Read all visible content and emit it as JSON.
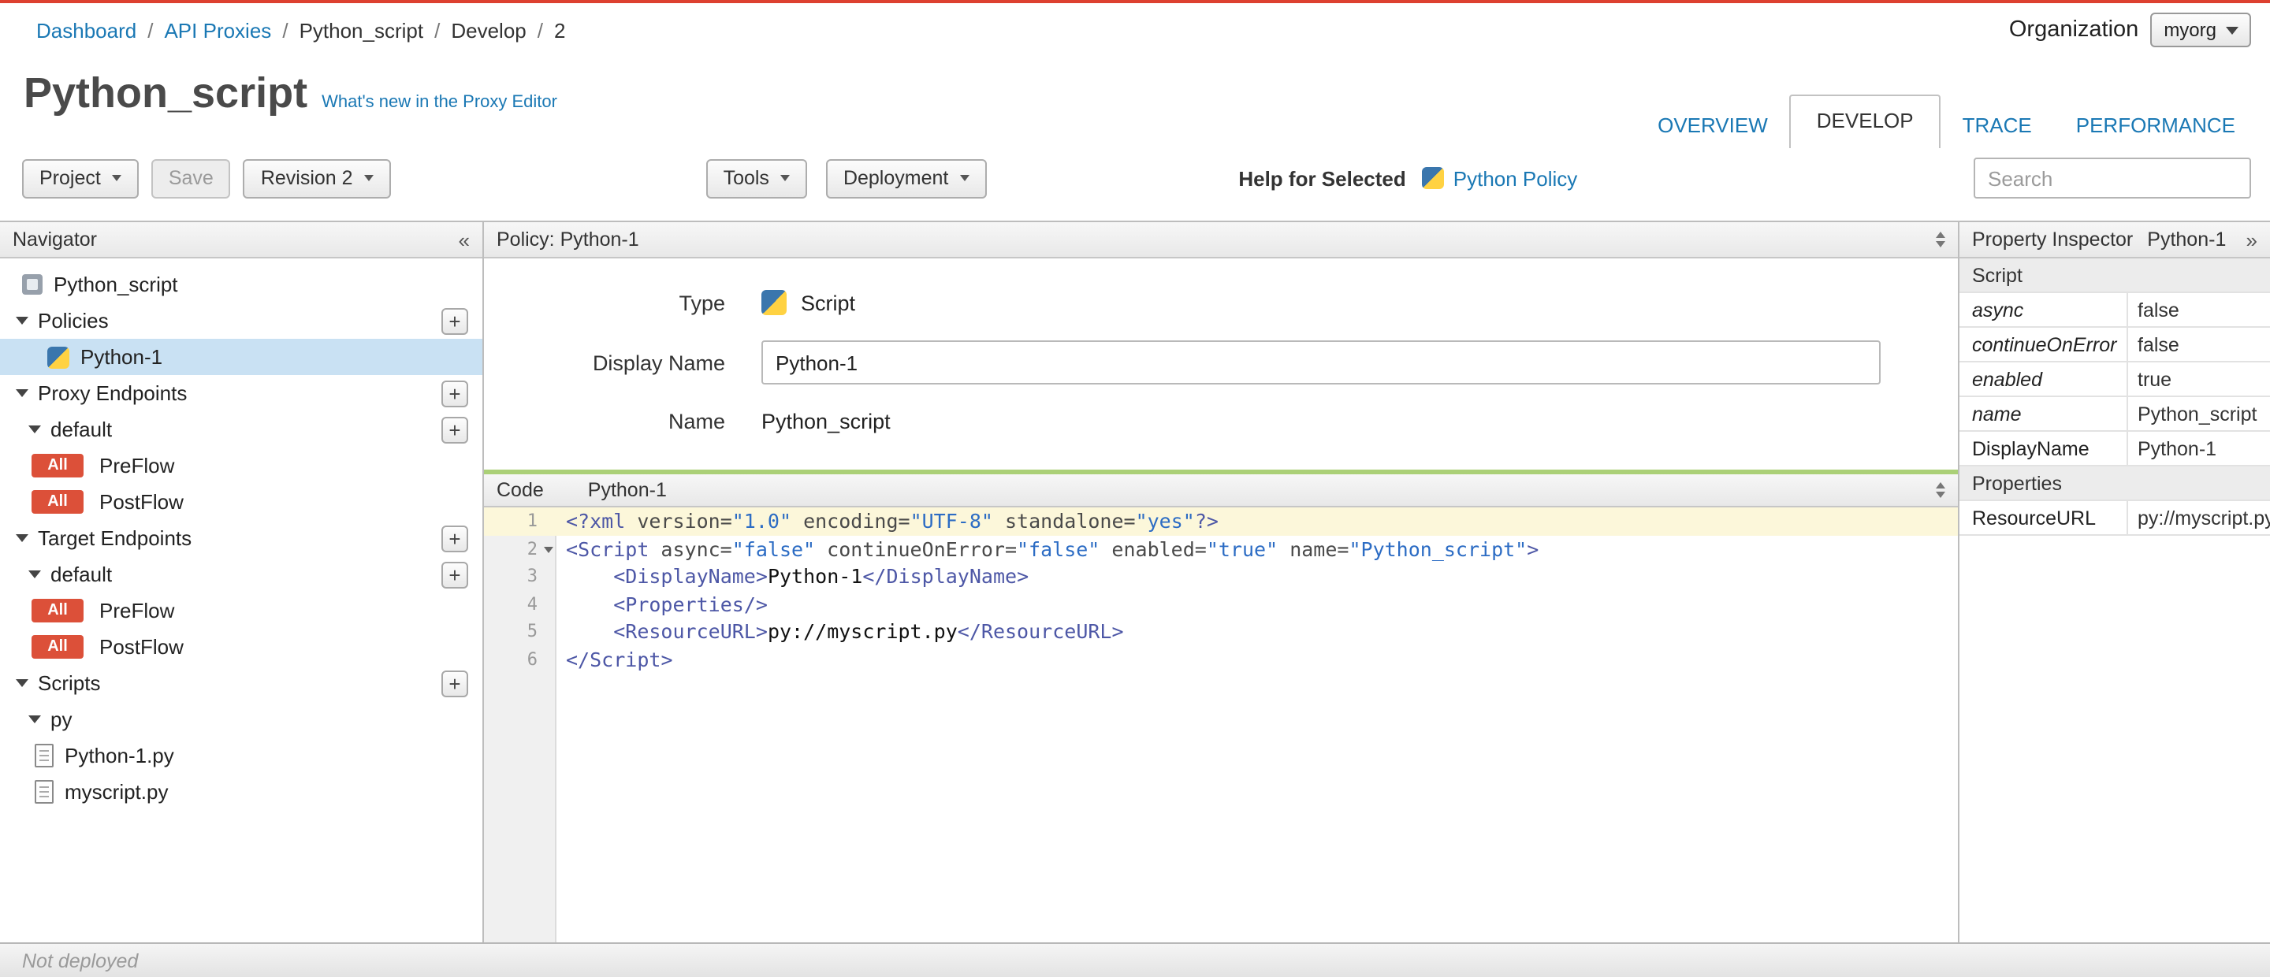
{
  "breadcrumb": {
    "separator": "/",
    "items": [
      {
        "label": "Dashboard",
        "link": true
      },
      {
        "label": "API Proxies",
        "link": true
      },
      {
        "label": "Python_script",
        "link": false
      },
      {
        "label": "Develop",
        "link": false
      },
      {
        "label": "2",
        "link": false
      }
    ]
  },
  "org": {
    "label": "Organization",
    "value": "myorg"
  },
  "header": {
    "title": "Python_script",
    "whats_new": "What's new in the Proxy Editor"
  },
  "tabs": [
    {
      "label": "OVERVIEW",
      "active": false
    },
    {
      "label": "DEVELOP",
      "active": true
    },
    {
      "label": "TRACE",
      "active": false
    },
    {
      "label": "PERFORMANCE",
      "active": false
    }
  ],
  "toolbar": {
    "project": "Project",
    "save": "Save",
    "revision": "Revision 2",
    "tools": "Tools",
    "deployment": "Deployment",
    "help_for_selected": "Help for Selected",
    "policy_link": "Python Policy",
    "search_placeholder": "Search"
  },
  "navigator": {
    "title": "Navigator",
    "collapse_icon": "chevrons-left",
    "items": [
      {
        "label": "Python_script",
        "icon": "proxy",
        "indent": 14
      },
      {
        "label": "Policies",
        "caret": true,
        "plus": true,
        "indent": 10
      },
      {
        "label": "Python-1",
        "icon": "python",
        "selected": true,
        "indent": 30
      },
      {
        "label": "Proxy Endpoints",
        "caret": true,
        "plus": true,
        "indent": 10
      },
      {
        "label": "default",
        "caret": true,
        "plus": true,
        "indent": 18
      },
      {
        "label": "PreFlow",
        "badge": "All",
        "indent": 20
      },
      {
        "label": "PostFlow",
        "badge": "All",
        "indent": 20
      },
      {
        "label": "Target Endpoints",
        "caret": true,
        "plus": true,
        "indent": 10
      },
      {
        "label": "default",
        "caret": true,
        "plus": true,
        "indent": 18
      },
      {
        "label": "PreFlow",
        "badge": "All",
        "indent": 20
      },
      {
        "label": "PostFlow",
        "badge": "All",
        "indent": 20
      },
      {
        "label": "Scripts",
        "caret": true,
        "plus": true,
        "indent": 10
      },
      {
        "label": "py",
        "caret": true,
        "indent": 18
      },
      {
        "label": "Python-1.py",
        "icon": "file",
        "indent": 22
      },
      {
        "label": "myscript.py",
        "icon": "file",
        "indent": 22
      }
    ]
  },
  "policy_panel": {
    "title": "Policy: Python-1",
    "type_label": "Type",
    "type_value": "Script",
    "display_name_label": "Display Name",
    "display_name_value": "Python-1",
    "name_label": "Name",
    "name_value": "Python_script"
  },
  "code": {
    "label": "Code",
    "name": "Python-1",
    "lines": [
      {
        "hl": true,
        "tokens": [
          [
            "punc",
            "<?"
          ],
          [
            "tag",
            "xml"
          ],
          [
            "attr",
            " version="
          ],
          [
            "str",
            "\"1.0\""
          ],
          [
            "attr",
            " encoding="
          ],
          [
            "str",
            "\"UTF-8\""
          ],
          [
            "attr",
            " standalone="
          ],
          [
            "str",
            "\"yes\""
          ],
          [
            "punc",
            "?>"
          ]
        ]
      },
      {
        "fold": true,
        "tokens": [
          [
            "punc",
            "<"
          ],
          [
            "tag",
            "Script"
          ],
          [
            "attr",
            " async="
          ],
          [
            "str",
            "\"false\""
          ],
          [
            "attr",
            " continueOnError="
          ],
          [
            "str",
            "\"false\""
          ],
          [
            "attr",
            " enabled="
          ],
          [
            "str",
            "\"true\""
          ],
          [
            "attr",
            " name="
          ],
          [
            "str",
            "\"Python_script\""
          ],
          [
            "punc",
            ">"
          ]
        ]
      },
      {
        "tokens": [
          [
            "text",
            "    "
          ],
          [
            "punc",
            "<"
          ],
          [
            "tag",
            "DisplayName"
          ],
          [
            "punc",
            ">"
          ],
          [
            "text",
            "Python-1"
          ],
          [
            "punc",
            "</"
          ],
          [
            "tag",
            "DisplayName"
          ],
          [
            "punc",
            ">"
          ]
        ]
      },
      {
        "tokens": [
          [
            "text",
            "    "
          ],
          [
            "punc",
            "<"
          ],
          [
            "tag",
            "Properties"
          ],
          [
            "punc",
            "/>"
          ]
        ]
      },
      {
        "tokens": [
          [
            "text",
            "    "
          ],
          [
            "punc",
            "<"
          ],
          [
            "tag",
            "ResourceURL"
          ],
          [
            "punc",
            ">"
          ],
          [
            "text",
            "py://myscript.py"
          ],
          [
            "punc",
            "</"
          ],
          [
            "tag",
            "ResourceURL"
          ],
          [
            "punc",
            ">"
          ]
        ]
      },
      {
        "tokens": [
          [
            "punc",
            "</"
          ],
          [
            "tag",
            "Script"
          ],
          [
            "punc",
            ">"
          ]
        ]
      }
    ]
  },
  "inspector": {
    "title": "Property Inspector",
    "subtitle": "Python-1",
    "rows": [
      {
        "name": "Script",
        "section": true
      },
      {
        "name": "async",
        "value": "false",
        "italic": true
      },
      {
        "name": "continueOnError",
        "value": "false",
        "italic": true
      },
      {
        "name": "enabled",
        "value": "true",
        "italic": true
      },
      {
        "name": "name",
        "value": "Python_script",
        "italic": true
      },
      {
        "name": "DisplayName",
        "value": "Python-1"
      },
      {
        "name": "Properties",
        "section": true
      },
      {
        "name": "ResourceURL",
        "value": "py://myscript.py"
      }
    ]
  },
  "statusbar": {
    "text": "Not deployed"
  }
}
